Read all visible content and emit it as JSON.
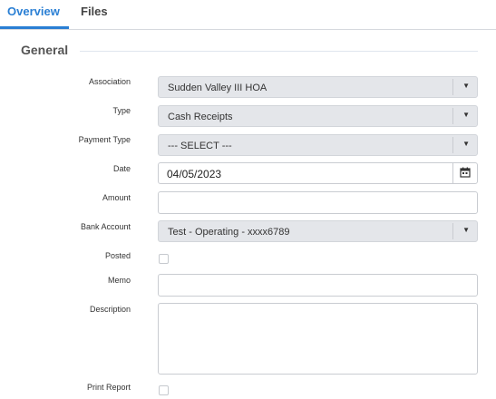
{
  "tabs": {
    "overview": "Overview",
    "files": "Files"
  },
  "section": {
    "title": "General"
  },
  "form": {
    "association": {
      "label": "Association",
      "value": "Sudden Valley III HOA"
    },
    "type": {
      "label": "Type",
      "value": "Cash Receipts"
    },
    "payment_type": {
      "label": "Payment Type",
      "value": "--- SELECT ---"
    },
    "date": {
      "label": "Date",
      "value": "04/05/2023"
    },
    "amount": {
      "label": "Amount",
      "value": ""
    },
    "bank_account": {
      "label": "Bank Account",
      "value": "Test - Operating - xxxx6789"
    },
    "posted": {
      "label": "Posted",
      "checked": false
    },
    "memo": {
      "label": "Memo",
      "value": ""
    },
    "description": {
      "label": "Description",
      "value": ""
    },
    "print_report": {
      "label": "Print Report",
      "checked": false
    }
  },
  "icons": {
    "dropdown": "chevron-down-icon",
    "calendar": "calendar-icon"
  },
  "colors": {
    "accent": "#2a7fd4",
    "select_bg": "#e4e6ea"
  }
}
